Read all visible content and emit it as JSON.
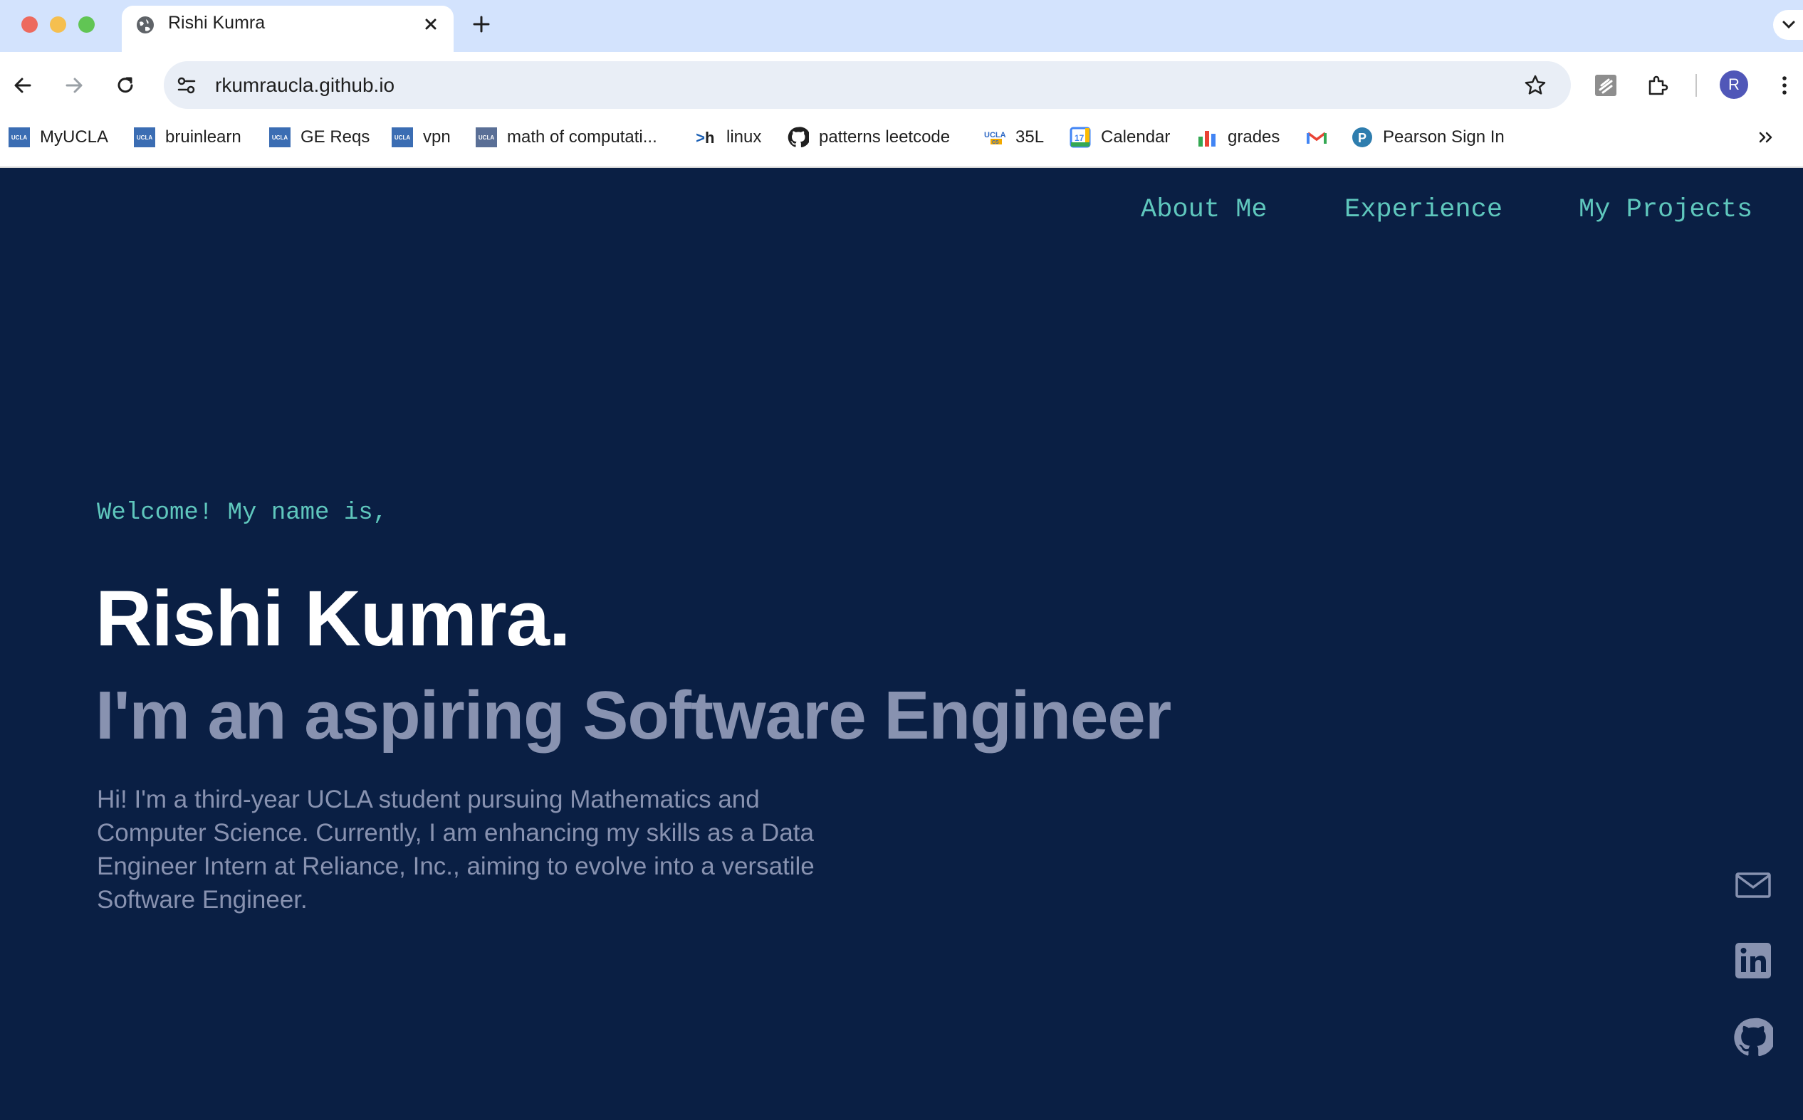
{
  "browser": {
    "tab_title": "Rishi Kumra",
    "url": "rkumraucla.github.io",
    "avatar_letter": "R",
    "bookmarks": [
      {
        "label": "MyUCLA",
        "icon": "ucla-icon"
      },
      {
        "label": "bruinlearn",
        "icon": "ucla-icon"
      },
      {
        "label": "GE Reqs",
        "icon": "ucla-icon"
      },
      {
        "label": "vpn",
        "icon": "ucla-icon"
      },
      {
        "label": "math of computati...",
        "icon": "ucla-icon"
      },
      {
        "label": "linux",
        "icon": "terminal-h-icon"
      },
      {
        "label": "patterns leetcode",
        "icon": "github-icon"
      },
      {
        "label": "35L",
        "icon": "ucla-cs-icon"
      },
      {
        "label": "Calendar",
        "icon": "calendar-icon"
      },
      {
        "label": "grades",
        "icon": "bar-chart-icon"
      },
      {
        "label": "",
        "icon": "gmail-icon"
      },
      {
        "label": "Pearson Sign In",
        "icon": "pearson-icon"
      }
    ]
  },
  "nav": {
    "about": "About Me",
    "experience": "Experience",
    "projects": "My Projects"
  },
  "hero": {
    "welcome": "Welcome! My name is,",
    "name": "Rishi Kumra.",
    "tagline": "I'm an aspiring Software Engineer",
    "bio": "Hi! I'm a third-year UCLA student pursuing Mathematics and Computer Science. Currently, I am enhancing my skills as a Data Engineer Intern at Reliance, Inc., aiming to evolve into a versatile Software Engineer."
  },
  "social": [
    "mail-icon",
    "linkedin-icon",
    "github-icon"
  ],
  "colors": {
    "page_bg": "#0a1f44",
    "accent": "#5fc7bd",
    "muted_text": "#8892b0",
    "heading": "#ffffff"
  }
}
